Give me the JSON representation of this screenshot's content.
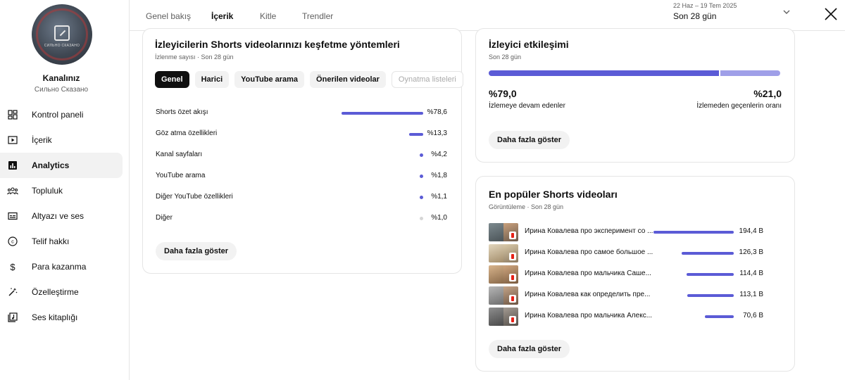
{
  "sidebar": {
    "channel_name": "Kanalınız",
    "channel_handle": "Сильно Сказано",
    "avatar_text": "СИЛЬНО СКАЗАНО",
    "items": [
      {
        "label": "Kontrol paneli",
        "icon": "dashboard-icon"
      },
      {
        "label": "İçerik",
        "icon": "content-icon"
      },
      {
        "label": "Analytics",
        "icon": "analytics-icon",
        "active": true
      },
      {
        "label": "Topluluk",
        "icon": "community-icon"
      },
      {
        "label": "Altyazı ve ses",
        "icon": "subtitles-icon"
      },
      {
        "label": "Telif hakkı",
        "icon": "copyright-icon"
      },
      {
        "label": "Para kazanma",
        "icon": "dollar-icon"
      },
      {
        "label": "Özelleştirme",
        "icon": "magic-wand-icon"
      },
      {
        "label": "Ses kitaplığı",
        "icon": "audio-library-icon"
      }
    ]
  },
  "topbar": {
    "tabs": [
      {
        "label": "Genel bakış"
      },
      {
        "label": "İçerik",
        "active": true
      },
      {
        "label": "Kitle"
      },
      {
        "label": "Trendler"
      }
    ],
    "date_range": "22 Haz – 19 Tem 2025",
    "period": "Son 28 gün",
    "dropdown_icon": "chevron-down-icon",
    "close_icon": "close-icon"
  },
  "discovery": {
    "title": "İzleyicilerin Shorts videolarınızı keşfetme yöntemleri",
    "subtitle": "İzlenme sayısı · Son 28 gün",
    "chips": [
      {
        "label": "Genel",
        "active": true
      },
      {
        "label": "Harici"
      },
      {
        "label": "YouTube arama"
      },
      {
        "label": "Önerilen videolar"
      },
      {
        "label": "Oynatma listeleri",
        "disabled": true
      }
    ],
    "sources": [
      {
        "name": "Shorts özet akışı",
        "value": "%78,6",
        "percent": 78.6
      },
      {
        "name": "Göz atma özellikleri",
        "value": "%13,3",
        "percent": 13.3
      },
      {
        "name": "Kanal sayfaları",
        "value": "%4,2",
        "percent": 4.2
      },
      {
        "name": "YouTube arama",
        "value": "%1,8",
        "percent": 1.8
      },
      {
        "name": "Diğer YouTube özellikleri",
        "value": "%1,1",
        "percent": 1.1
      },
      {
        "name": "Diğer",
        "value": "%1,0",
        "percent": 1.0,
        "muted": true
      }
    ],
    "more_label": "Daha fazla göster",
    "bar_color": "#5b5bd6"
  },
  "engagement": {
    "title": "İzleyici etkileşimi",
    "subtitle": "Son 28 gün",
    "continued_pct": "%79,0",
    "continued_label": "İzlemeye devam edenler",
    "continued_fraction": 0.79,
    "swiped_pct": "%21,0",
    "swiped_label": "İzlemeden geçenlerin oranı",
    "more_label": "Daha fazla göster",
    "primary_color": "#5b5bd6",
    "secondary_color": "#9f9fe8"
  },
  "top_shorts": {
    "title": "En popüler Shorts videoları",
    "subtitle": "Görüntüleme · Son 28 gün",
    "videos": [
      {
        "title": "Ирина Ковалева про эксперимент со ...",
        "value": "194,4 B",
        "views": 194.4
      },
      {
        "title": "Ирина Ковалева про самое большое ...",
        "value": "126,3 B",
        "views": 126.3
      },
      {
        "title": "Ирина Ковалева про мальчика Саше...",
        "value": "114,4 B",
        "views": 114.4
      },
      {
        "title": "Ирина Ковалева как определить пре...",
        "value": "113,1 B",
        "views": 113.1
      },
      {
        "title": "Ирина Ковалева про мальчика Алекс...",
        "value": "70,6 B",
        "views": 70.6
      }
    ],
    "more_label": "Daha fazla göster"
  }
}
